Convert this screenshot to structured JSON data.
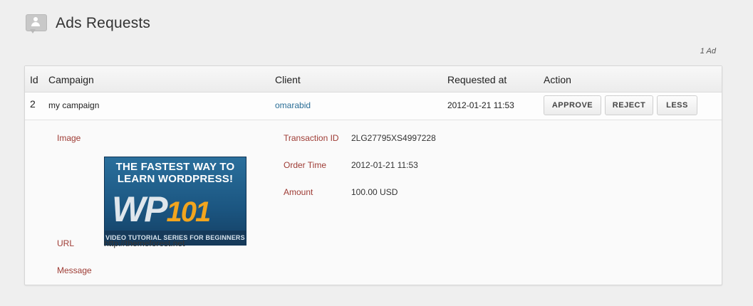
{
  "page": {
    "title": "Ads Requests",
    "count": "1 Ad"
  },
  "table": {
    "headers": {
      "id": "Id",
      "campaign": "Campaign",
      "client": "Client",
      "requested_at": "Requested at",
      "action": "Action"
    },
    "row": {
      "id": "2",
      "campaign": "my campaign",
      "client": "omarabid",
      "requested_at": "2012-01-21 11:53",
      "buttons": {
        "approve": "APPROVE",
        "reject": "REJECT",
        "less": "LESS"
      }
    }
  },
  "details": {
    "image_label": "Image",
    "url_label": "URL",
    "url": "http://themeforest.net",
    "message_label": "Message",
    "transaction_id_label": "Transaction ID",
    "transaction_id": "2LG27795XS4997228",
    "order_time_label": "Order Time",
    "order_time": "2012-01-21 11:53",
    "amount_label": "Amount",
    "amount": "100.00 USD",
    "banner": {
      "headline": "THE FASTEST WAY TO LEARN WORDPRESS!",
      "logo_text": "WP",
      "logo_number": "101",
      "tagline": "VIDEO TUTORIAL SERIES FOR BEGINNERS"
    }
  },
  "colors": {
    "label": "#9e3b34",
    "link": "#2a6e96",
    "background": "#efefef"
  },
  "icons": {
    "header": "user-comment-icon"
  }
}
